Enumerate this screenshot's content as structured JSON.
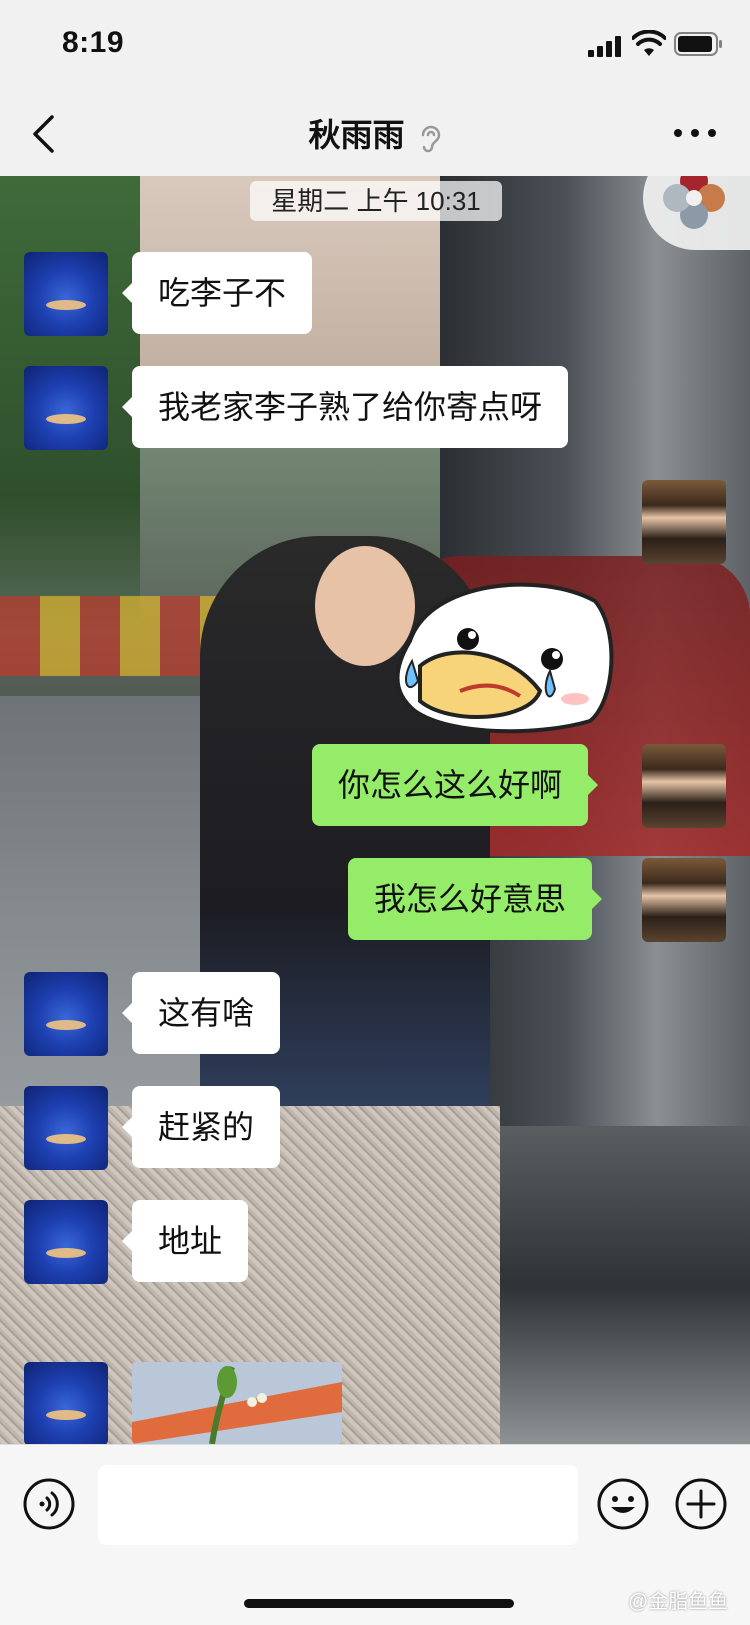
{
  "status_bar": {
    "time": "8:19"
  },
  "nav": {
    "title": "秋雨雨"
  },
  "chat": {
    "timestamp": "星期二 上午 10:31",
    "messages": [
      {
        "side": "in",
        "text": "吃李子不"
      },
      {
        "side": "in",
        "text": "我老家李子熟了给你寄点呀"
      },
      {
        "side": "out",
        "type": "sticker"
      },
      {
        "side": "out",
        "text": "你怎么这么好啊"
      },
      {
        "side": "out",
        "text": "我怎么好意思"
      },
      {
        "side": "in",
        "text": "这有啥"
      },
      {
        "side": "in",
        "text": "赶紧的"
      },
      {
        "side": "in",
        "text": "地址"
      },
      {
        "side": "in",
        "type": "image"
      }
    ]
  },
  "input_bar": {
    "placeholder": ""
  },
  "watermark": "@金脂鱼鱼",
  "colors": {
    "outgoing_bubble": "#95ec69",
    "incoming_bubble": "#ffffff",
    "bar_bg": "#f1f1f1"
  }
}
